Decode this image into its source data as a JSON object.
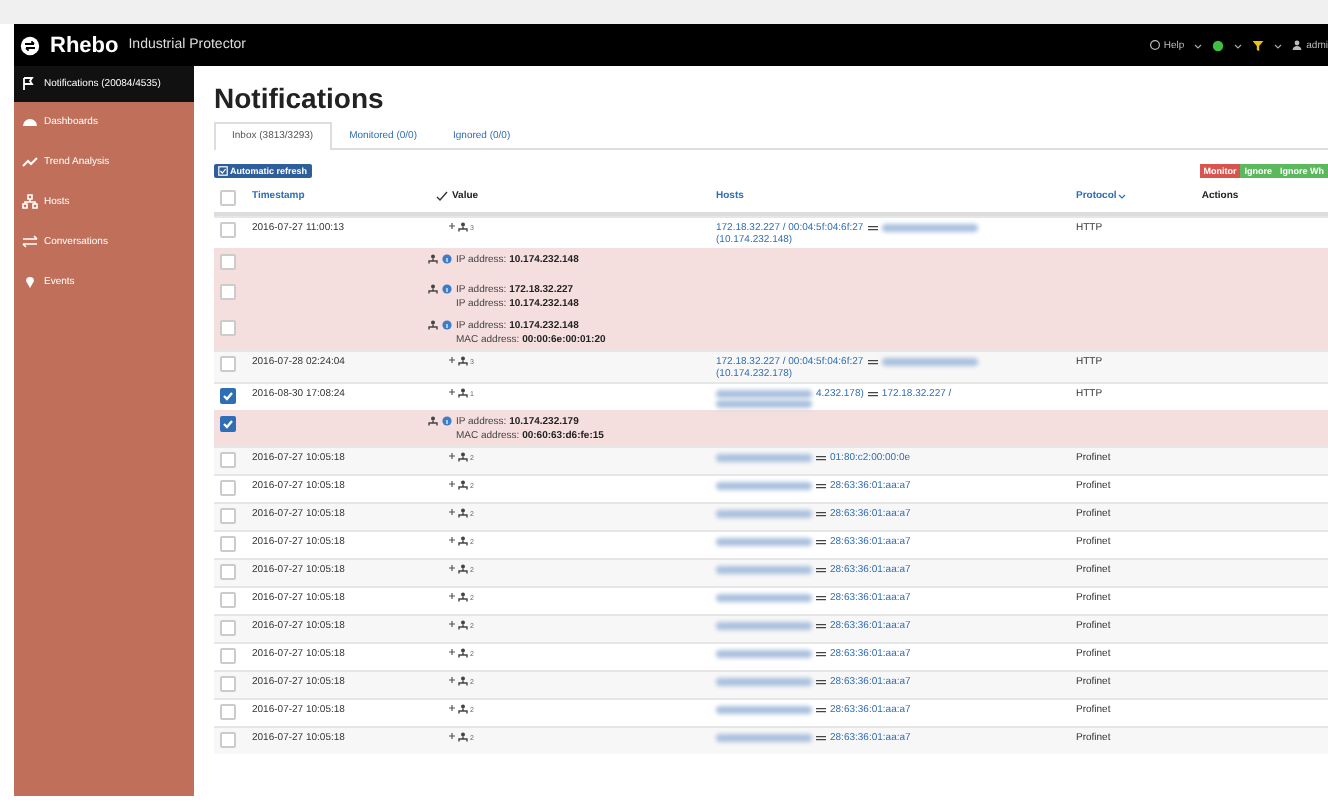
{
  "header": {
    "brand": "Rhebo",
    "product": "Industrial Protector",
    "help": "Help",
    "user": "admi"
  },
  "sidebar": {
    "items": [
      {
        "label": "Notifications (20084/4535)",
        "selected": true
      },
      {
        "label": "Dashboards",
        "selected": false
      },
      {
        "label": "Trend Analysis",
        "selected": false
      },
      {
        "label": "Hosts",
        "selected": false
      },
      {
        "label": "Conversations",
        "selected": false
      },
      {
        "label": "Events",
        "selected": false
      }
    ]
  },
  "page_title": "Notifications",
  "tabs": [
    {
      "label": "Inbox (3813/3293)",
      "selected": true
    },
    {
      "label": "Monitored (0/0)",
      "selected": false
    },
    {
      "label": "Ignored (0/0)",
      "selected": false
    }
  ],
  "refresh_button": {
    "label": "Automatic refresh",
    "checked": true
  },
  "action_buttons": [
    {
      "label": "Monitor",
      "kind": "monitor"
    },
    {
      "label": "Ignore",
      "kind": "ignore"
    },
    {
      "label": "Ignore Wh",
      "kind": "ignore"
    }
  ],
  "table": {
    "select_all": false,
    "columns": [
      "Timestamp",
      "Value",
      "Hosts",
      "Protocol",
      "Actions"
    ],
    "rows": [
      {
        "kind": "event",
        "checked": false,
        "timestamp": "2016-07-27 11:00:13",
        "count": "3",
        "hosts": [
          [
            {
              "kind": "text",
              "text": "172.18.32.227 / 00:04:5f:04:6f:27"
            },
            {
              "kind": "link"
            },
            {
              "kind": "blurred"
            }
          ],
          [
            {
              "kind": "text",
              "text": "(10.174.232.148)"
            }
          ]
        ],
        "protocol": "HTTP"
      },
      {
        "kind": "detail",
        "checked": false,
        "lines": [
          "IP address: **10.174.232.148**"
        ]
      },
      {
        "kind": "detail",
        "checked": false,
        "lines": [
          "IP address: **172.18.32.227**",
          "IP address: **10.174.232.148**"
        ]
      },
      {
        "kind": "detail",
        "checked": false,
        "lines": [
          "IP address: **10.174.232.148**",
          "MAC address: **00:00:6e:00:01:20**"
        ]
      },
      {
        "kind": "event",
        "checked": false,
        "timestamp": "2016-07-28 02:24:04",
        "count": "3",
        "hosts": [
          [
            {
              "kind": "text",
              "text": "172.18.32.227 / 00:04:5f:04:6f:27"
            },
            {
              "kind": "link"
            },
            {
              "kind": "blurred"
            }
          ],
          [
            {
              "kind": "text",
              "text": "(10.174.232.178)"
            }
          ]
        ],
        "protocol": "HTTP"
      },
      {
        "kind": "event",
        "checked": true,
        "timestamp": "2016-08-30 17:08:24",
        "count": "1",
        "hosts": [
          [
            {
              "kind": "blurred"
            },
            {
              "kind": "text",
              "text": "4.232.178)"
            },
            {
              "kind": "link"
            },
            {
              "kind": "text",
              "text": "172.18.32.227 /"
            }
          ],
          [
            {
              "kind": "blurred"
            }
          ]
        ],
        "protocol": "HTTP"
      },
      {
        "kind": "detail",
        "checked": true,
        "lines": [
          "IP address: **10.174.232.179**",
          "MAC address: **00:60:63:d6:fe:15**"
        ]
      },
      {
        "kind": "event",
        "checked": false,
        "timestamp": "2016-07-27 10:05:18",
        "count": "2",
        "hosts": [
          [
            {
              "kind": "blurred"
            },
            {
              "kind": "link"
            },
            {
              "kind": "text",
              "text": "01:80:c2:00:00:0e"
            }
          ]
        ],
        "protocol": "Profinet"
      },
      {
        "kind": "event",
        "checked": false,
        "timestamp": "2016-07-27 10:05:18",
        "count": "2",
        "hosts": [
          [
            {
              "kind": "blurred"
            },
            {
              "kind": "link"
            },
            {
              "kind": "text",
              "text": "28:63:36:01:aa:a7"
            }
          ]
        ],
        "protocol": "Profinet"
      },
      {
        "kind": "event",
        "checked": false,
        "timestamp": "2016-07-27 10:05:18",
        "count": "2",
        "hosts": [
          [
            {
              "kind": "blurred"
            },
            {
              "kind": "link"
            },
            {
              "kind": "text",
              "text": "28:63:36:01:aa:a7"
            }
          ]
        ],
        "protocol": "Profinet"
      },
      {
        "kind": "event",
        "checked": false,
        "timestamp": "2016-07-27 10:05:18",
        "count": "2",
        "hosts": [
          [
            {
              "kind": "blurred"
            },
            {
              "kind": "link"
            },
            {
              "kind": "text",
              "text": "28:63:36:01:aa:a7"
            }
          ]
        ],
        "protocol": "Profinet"
      },
      {
        "kind": "event",
        "checked": false,
        "timestamp": "2016-07-27 10:05:18",
        "count": "2",
        "hosts": [
          [
            {
              "kind": "blurred"
            },
            {
              "kind": "link"
            },
            {
              "kind": "text",
              "text": "28:63:36:01:aa:a7"
            }
          ]
        ],
        "protocol": "Profinet"
      },
      {
        "kind": "event",
        "checked": false,
        "timestamp": "2016-07-27 10:05:18",
        "count": "2",
        "hosts": [
          [
            {
              "kind": "blurred"
            },
            {
              "kind": "link"
            },
            {
              "kind": "text",
              "text": "28:63:36:01:aa:a7"
            }
          ]
        ],
        "protocol": "Profinet"
      },
      {
        "kind": "event",
        "checked": false,
        "timestamp": "2016-07-27 10:05:18",
        "count": "2",
        "hosts": [
          [
            {
              "kind": "blurred"
            },
            {
              "kind": "link"
            },
            {
              "kind": "text",
              "text": "28:63:36:01:aa:a7"
            }
          ]
        ],
        "protocol": "Profinet"
      },
      {
        "kind": "event",
        "checked": false,
        "timestamp": "2016-07-27 10:05:18",
        "count": "2",
        "hosts": [
          [
            {
              "kind": "blurred"
            },
            {
              "kind": "link"
            },
            {
              "kind": "text",
              "text": "28:63:36:01:aa:a7"
            }
          ]
        ],
        "protocol": "Profinet"
      },
      {
        "kind": "event",
        "checked": false,
        "timestamp": "2016-07-27 10:05:18",
        "count": "2",
        "hosts": [
          [
            {
              "kind": "blurred"
            },
            {
              "kind": "link"
            },
            {
              "kind": "text",
              "text": "28:63:36:01:aa:a7"
            }
          ]
        ],
        "protocol": "Profinet"
      },
      {
        "kind": "event",
        "checked": false,
        "timestamp": "2016-07-27 10:05:18",
        "count": "2",
        "hosts": [
          [
            {
              "kind": "blurred"
            },
            {
              "kind": "link"
            },
            {
              "kind": "text",
              "text": "28:63:36:01:aa:a7"
            }
          ]
        ],
        "protocol": "Profinet"
      },
      {
        "kind": "event",
        "checked": false,
        "timestamp": "2016-07-27 10:05:18",
        "count": "2",
        "hosts": [
          [
            {
              "kind": "blurred"
            },
            {
              "kind": "link"
            },
            {
              "kind": "text",
              "text": "28:63:36:01:aa:a7"
            }
          ]
        ],
        "protocol": "Profinet"
      }
    ]
  }
}
